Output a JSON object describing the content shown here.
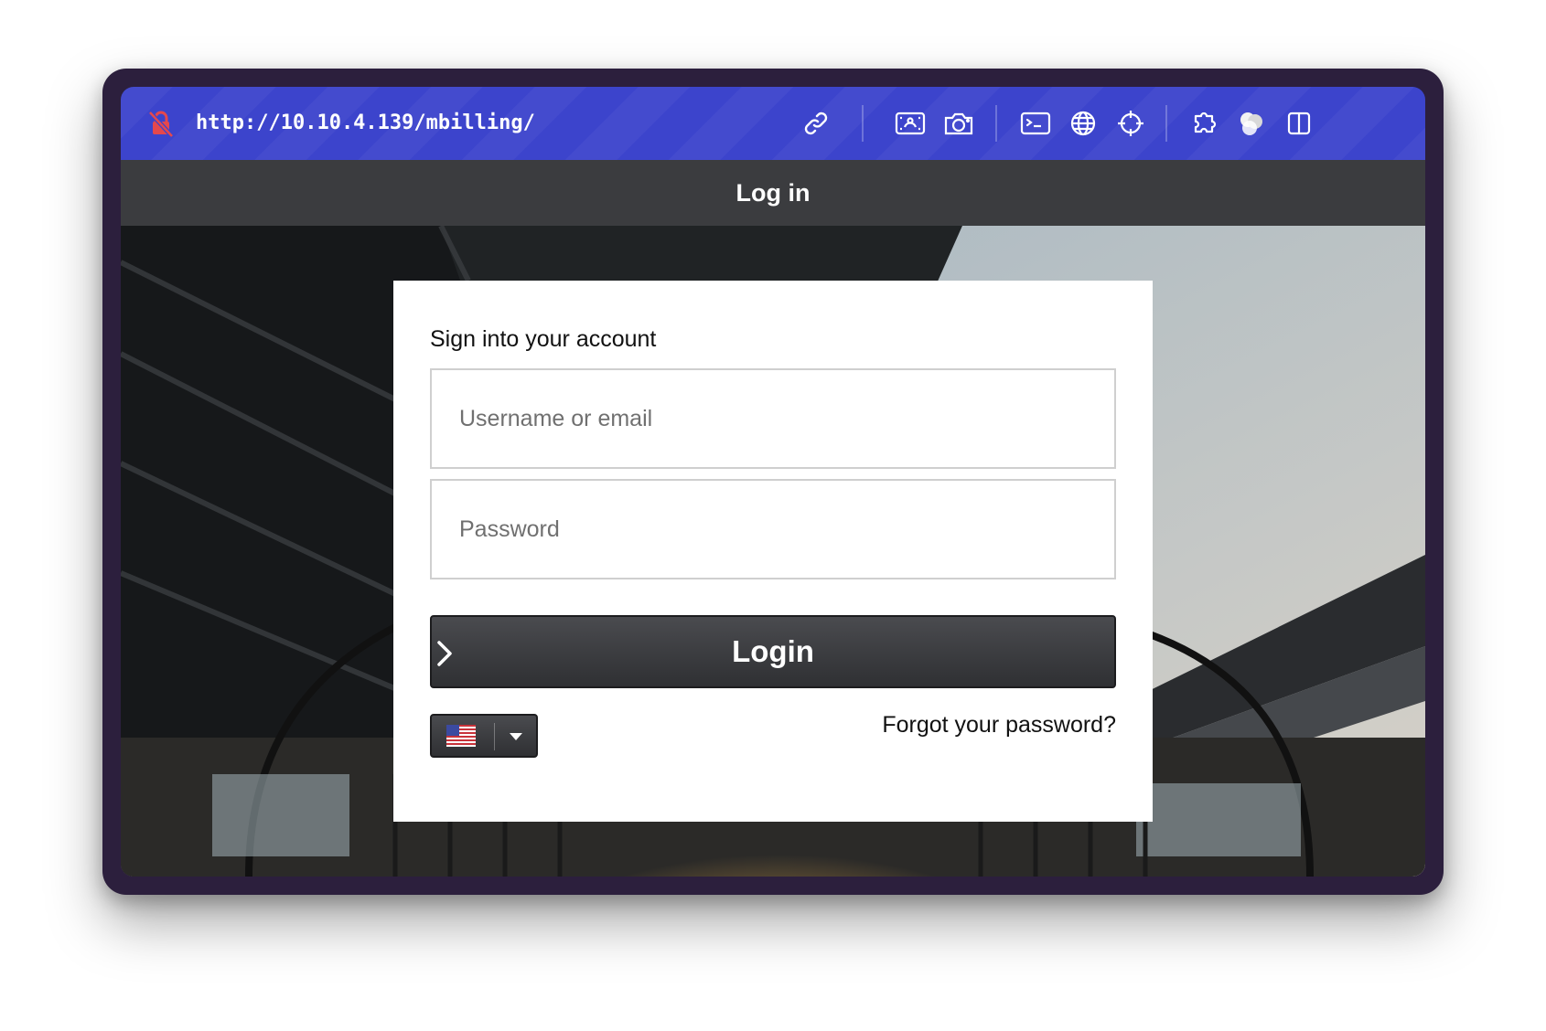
{
  "browser": {
    "url": "http://10.10.4.139/mbilling/",
    "icons": [
      "not-secure-lock-icon",
      "link-icon",
      "screenshot-region-icon",
      "camera-icon",
      "terminal-icon",
      "globe-icon",
      "crosshair-icon",
      "extensions-icon",
      "theme-icon",
      "split-view-icon"
    ],
    "accent_color": "#3c44cc"
  },
  "header": {
    "title": "Log in"
  },
  "login": {
    "heading": "Sign into your account",
    "username_placeholder": "Username or email",
    "password_placeholder": "Password",
    "submit_label": "Login",
    "forgot_label": "Forgot your password?",
    "language_flag": "us-flag-icon"
  }
}
